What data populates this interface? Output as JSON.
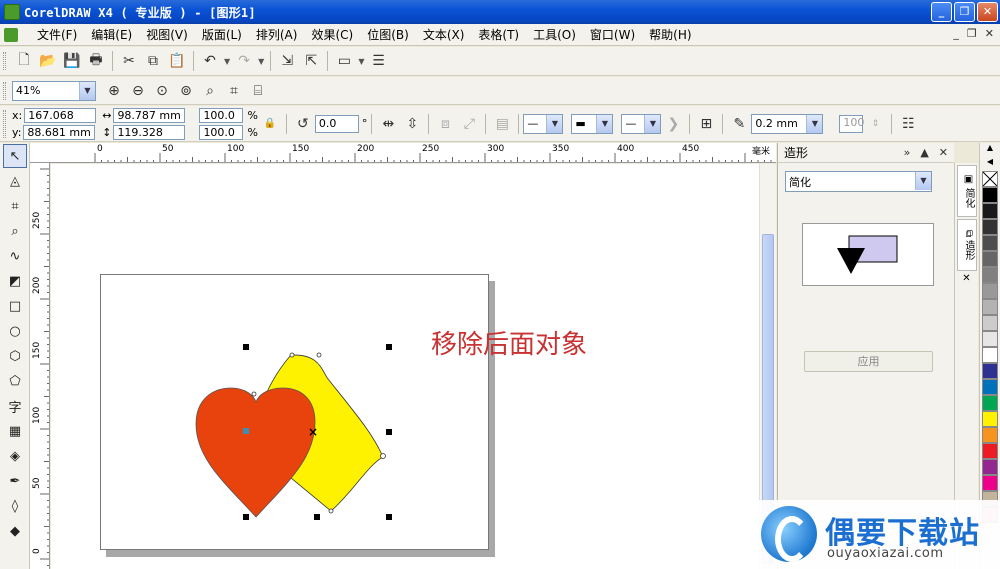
{
  "window": {
    "title": "CorelDRAW X4 ( 专业版 ) - [图形1]"
  },
  "menu": [
    "文件(F)",
    "编辑(E)",
    "视图(V)",
    "版面(L)",
    "排列(A)",
    "效果(C)",
    "位图(B)",
    "文本(X)",
    "表格(T)",
    "工具(O)",
    "窗口(W)",
    "帮助(H)"
  ],
  "zoom": {
    "value": "41%"
  },
  "property_bar": {
    "x": "167.068 mm",
    "y": "88.681 mm",
    "width": "98.787 mm",
    "height": "119.328 mm",
    "scale_x": "100.0",
    "scale_y": "100.0",
    "percent": "%",
    "rotation": "0.0",
    "degree": "°",
    "outline": "0.2 mm",
    "opacity": "100"
  },
  "rulers": {
    "top": [
      "0",
      "50",
      "100",
      "150",
      "200",
      "250",
      "300",
      "350",
      "400",
      "450"
    ],
    "top_unit": "毫米",
    "left": [
      "250",
      "200",
      "150",
      "100",
      "50",
      "0"
    ]
  },
  "canvas": {
    "annotation": "移除后面对象"
  },
  "colors": {
    "heart": "#e8430c",
    "blob": "#fff200",
    "annotation": "#c83232",
    "preview_rect": "#cfc9ef"
  },
  "docker": {
    "title": "造形",
    "mode": "简化",
    "apply_label": "应用",
    "tabs": [
      "简化",
      "造形"
    ]
  },
  "palette": [
    "#ffffff",
    "#000000",
    "#1a1a1a",
    "#333333",
    "#4d4d4d",
    "#666666",
    "#808080",
    "#999999",
    "#b3b3b3",
    "#cccccc",
    "#e6e6e6",
    "#ffffff",
    "#2e3192",
    "#0072bc",
    "#00a651",
    "#fff200",
    "#f7941d",
    "#ed1c24",
    "#92278f",
    "#ec008c",
    "#c2b59b",
    "#f49ac1"
  ],
  "watermark": {
    "title": "偶要下载站",
    "url": "ouyaoxiazai.com"
  }
}
